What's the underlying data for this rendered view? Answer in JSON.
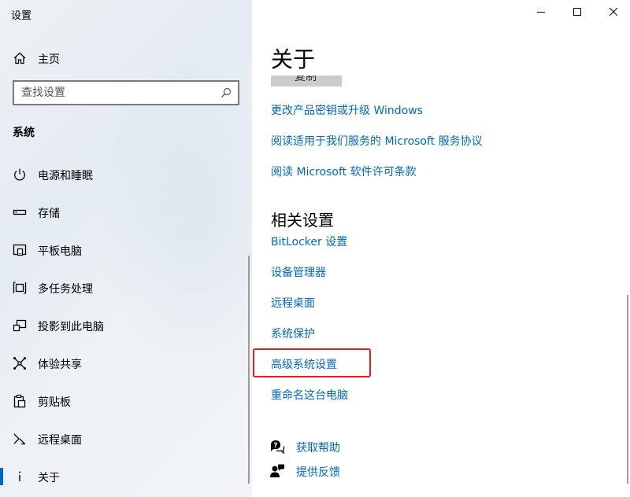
{
  "window": {
    "title": "设置",
    "controls": {
      "minimize": "minimize-icon",
      "maximize": "maximize-icon",
      "close": "close-icon"
    }
  },
  "sidebar": {
    "home_label": "主页",
    "search_placeholder": "查找设置",
    "section_title": "系统",
    "items": [
      {
        "label": "电源和睡眠",
        "icon": "power-icon"
      },
      {
        "label": "存储",
        "icon": "storage-icon"
      },
      {
        "label": "平板电脑",
        "icon": "tablet-icon"
      },
      {
        "label": "多任务处理",
        "icon": "multitasking-icon"
      },
      {
        "label": "投影到此电脑",
        "icon": "project-icon"
      },
      {
        "label": "体验共享",
        "icon": "shared-experiences-icon"
      },
      {
        "label": "剪贴板",
        "icon": "clipboard-icon"
      },
      {
        "label": "远程桌面",
        "icon": "remote-desktop-icon"
      },
      {
        "label": "关于",
        "icon": "info-icon",
        "selected": true
      }
    ]
  },
  "main": {
    "title": "关于",
    "copy_button": "复制",
    "links": [
      "更改产品密钥或升级 Windows",
      "阅读适用于我们服务的 Microsoft 服务协议",
      "阅读 Microsoft 软件许可条款"
    ],
    "related_title": "相关设置",
    "related_links": [
      "BitLocker 设置",
      "设备管理器",
      "远程桌面",
      "系统保护",
      "高级系统设置",
      "重命名这台电脑"
    ],
    "help": [
      {
        "label": "获取帮助",
        "icon": "help-icon"
      },
      {
        "label": "提供反馈",
        "icon": "feedback-icon"
      }
    ]
  },
  "colors": {
    "accent": "#0067c0",
    "highlight_box": "#e02020",
    "sidebar_bg": "#eef1f5"
  }
}
